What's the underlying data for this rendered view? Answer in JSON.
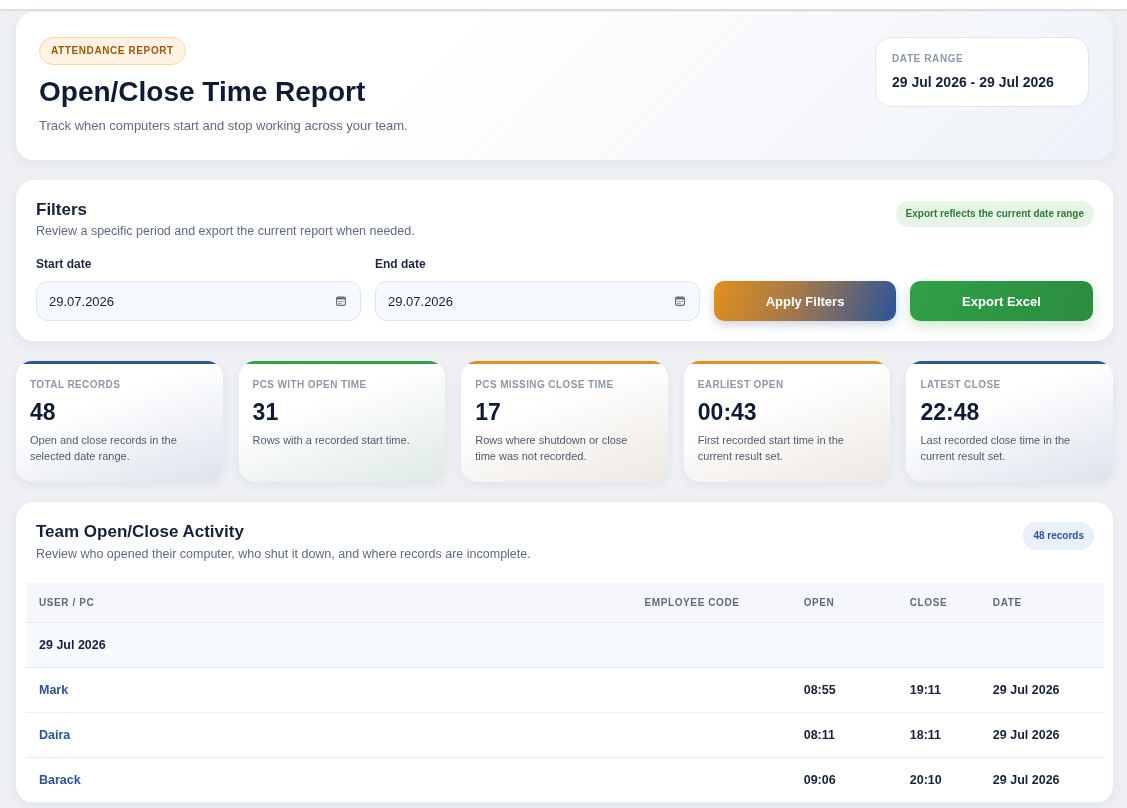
{
  "header": {
    "badge": "ATTENDANCE REPORT",
    "title": "Open/Close Time Report",
    "subtitle": "Track when computers start and stop working across your team.",
    "date_range": {
      "label": "DATE RANGE",
      "value": "29 Jul 2026 - 29 Jul 2026"
    }
  },
  "filters": {
    "title": "Filters",
    "subtitle": "Review a specific period and export the current report when needed.",
    "note": "Export reflects the current date range",
    "fields": [
      {
        "label": "Start date",
        "value": "29.07.2026"
      },
      {
        "label": "End date",
        "value": "29.07.2026"
      }
    ],
    "buttons": [
      {
        "label": "Apply Filters",
        "kind": "apply"
      },
      {
        "label": "Export Excel",
        "kind": "export"
      }
    ]
  },
  "stats": [
    {
      "label": "TOTAL RECORDS",
      "value": "48",
      "description": "Open and close records in the selected date range.",
      "color": "#2a5597"
    },
    {
      "label": "PCS WITH OPEN TIME",
      "value": "31",
      "description": "Rows with a recorded start time.",
      "color": "#33a047"
    },
    {
      "label": "PCS MISSING CLOSE TIME",
      "value": "17",
      "description": "Rows where shutdown or close time was not recorded.",
      "color": "#e0901c"
    },
    {
      "label": "EARLIEST OPEN",
      "value": "00:43",
      "description": "First recorded start time in the current result set.",
      "color": "#e0901c"
    },
    {
      "label": "LATEST CLOSE",
      "value": "22:48",
      "description": "Last recorded close time in the current result set.",
      "color": "#2a5597"
    }
  ],
  "activity": {
    "title": "Team Open/Close Activity",
    "subtitle": "Review who opened their computer, who shut it down, and where records are incomplete.",
    "count": "48 records",
    "table": {
      "columns": [
        "USER / PC",
        "EMPLOYEE CODE",
        "OPEN",
        "CLOSE",
        "DATE"
      ],
      "groups": [
        {
          "label": "29 Jul 2026",
          "rows": [
            {
              "user": "Mark",
              "open": "08:55",
              "close": "19:11",
              "date": "29 Jul 2026"
            },
            {
              "user": "Daira",
              "open": "08:11",
              "close": "18:11",
              "date": "29 Jul 2026"
            },
            {
              "user": "Barack",
              "open": "09:06",
              "close": "20:10",
              "date": "29 Jul 2026"
            }
          ]
        }
      ]
    }
  }
}
